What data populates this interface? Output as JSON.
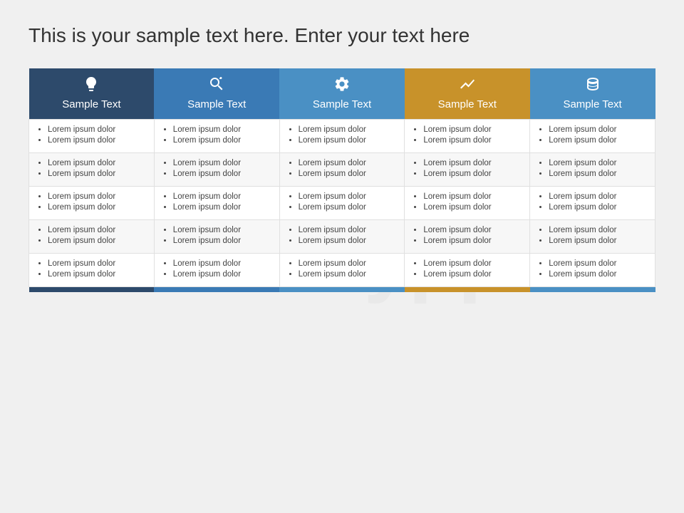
{
  "page": {
    "title": "This is your sample text here. Enter your text here",
    "watermark": "infinityppt"
  },
  "columns": [
    {
      "id": "col1",
      "label": "Sample Text",
      "icon": "lightbulb",
      "color": "#2d4a6b",
      "footer_color": "#2d4a6b"
    },
    {
      "id": "col2",
      "label": "Sample Text",
      "icon": "search-settings",
      "color": "#3a7ab5",
      "footer_color": "#3a7ab5"
    },
    {
      "id": "col3",
      "label": "Sample Text",
      "icon": "gear",
      "color": "#4a90c4",
      "footer_color": "#4a90c4"
    },
    {
      "id": "col4",
      "label": "Sample Text",
      "icon": "chart",
      "color": "#c8922a",
      "footer_color": "#c8922a"
    },
    {
      "id": "col5",
      "label": "Sample Text",
      "icon": "database",
      "color": "#4a90c4",
      "footer_color": "#4a90c4"
    }
  ],
  "rows": [
    {
      "cells": [
        [
          "Lorem ipsum dolor",
          "Lorem ipsum dolor"
        ],
        [
          "Lorem ipsum dolor",
          "Lorem ipsum dolor"
        ],
        [
          "Lorem ipsum dolor",
          "Lorem ipsum dolor"
        ],
        [
          "Lorem ipsum dolor",
          "Lorem ipsum dolor"
        ],
        [
          "Lorem ipsum dolor",
          "Lorem ipsum dolor"
        ]
      ]
    },
    {
      "cells": [
        [
          "Lorem ipsum dolor",
          "Lorem ipsum dolor"
        ],
        [
          "Lorem ipsum dolor",
          "Lorem ipsum dolor"
        ],
        [
          "Lorem ipsum dolor",
          "Lorem ipsum dolor"
        ],
        [
          "Lorem ipsum dolor",
          "Lorem ipsum dolor"
        ],
        [
          "Lorem ipsum dolor",
          "Lorem ipsum dolor"
        ]
      ]
    },
    {
      "cells": [
        [
          "Lorem ipsum dolor",
          "Lorem ipsum dolor"
        ],
        [
          "Lorem ipsum dolor",
          "Lorem ipsum dolor"
        ],
        [
          "Lorem ipsum dolor",
          "Lorem ipsum dolor"
        ],
        [
          "Lorem ipsum dolor",
          "Lorem ipsum dolor"
        ],
        [
          "Lorem ipsum dolor",
          "Lorem ipsum dolor"
        ]
      ]
    },
    {
      "cells": [
        [
          "Lorem ipsum dolor",
          "Lorem ipsum dolor"
        ],
        [
          "Lorem ipsum dolor",
          "Lorem ipsum dolor"
        ],
        [
          "Lorem ipsum dolor",
          "Lorem ipsum dolor"
        ],
        [
          "Lorem ipsum dolor",
          "Lorem ipsum dolor"
        ],
        [
          "Lorem ipsum dolor",
          "Lorem ipsum dolor"
        ]
      ]
    },
    {
      "cells": [
        [
          "Lorem ipsum dolor",
          "Lorem ipsum dolor"
        ],
        [
          "Lorem ipsum dolor",
          "Lorem ipsum dolor"
        ],
        [
          "Lorem ipsum dolor",
          "Lorem ipsum dolor"
        ],
        [
          "Lorem ipsum dolor",
          "Lorem ipsum dolor"
        ],
        [
          "Lorem ipsum dolor",
          "Lorem ipsum dolor"
        ]
      ]
    }
  ]
}
